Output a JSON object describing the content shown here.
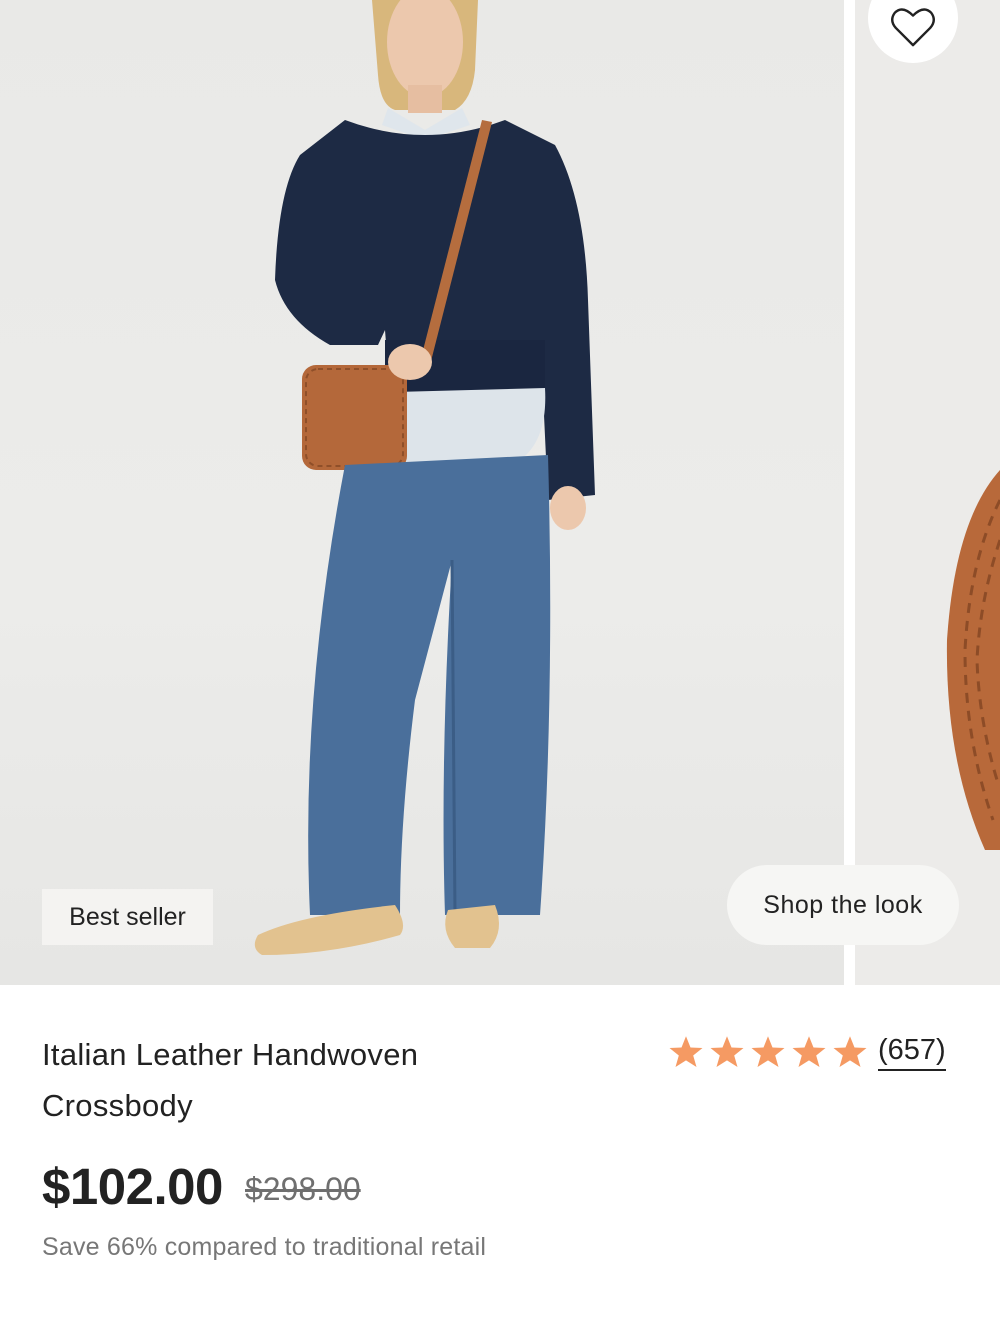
{
  "gallery": {
    "badge": "Best seller",
    "shop_the_look": "Shop the look",
    "favorite_icon": "heart-outline-icon"
  },
  "product": {
    "title_line1": "Italian Leather Handwoven",
    "title_line2": "Crossbody",
    "rating_stars": 5,
    "review_count": "(657)",
    "price": "$102.00",
    "original_price": "$298.00",
    "savings_text": "Save 66% compared to traditional retail"
  },
  "colors": {
    "star": "#f59a63",
    "text": "#222222",
    "muted": "#777777"
  }
}
